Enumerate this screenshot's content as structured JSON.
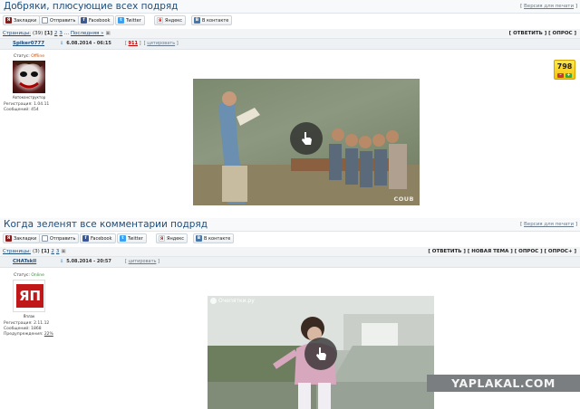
{
  "share": {
    "bookmarks": "Закладки",
    "send": "Отправить",
    "facebook": "Facebook",
    "twitter": "Twitter",
    "yandex": "Яндекс",
    "vk": "В контакте"
  },
  "topic1": {
    "title": "Добряки, плюсующие всех подряд",
    "print_link": "Версия для печати",
    "pages_label": "Страницы:",
    "pages_count": "(39)",
    "current_page": "[1]",
    "page2": "2",
    "page3": "3",
    "ellipsis": "...",
    "last": "Последняя »",
    "actions": "[ ОТВЕТИТЬ ] [ ОПРОС ]",
    "post": {
      "author": "Spiker0777",
      "date": "6.08.2014 - 06:15",
      "id": "911",
      "quote": "цитировать",
      "status_label": "Статус:",
      "status": "Offline",
      "rank": "Автоконструктор",
      "registered": "Регистрация: 1.04.11",
      "messages": "Сообщений: 454",
      "rating": "798",
      "minus": "–",
      "plus": "+"
    },
    "video_brand": "COUB"
  },
  "topic2": {
    "title": "Когда зеленят все комментарии подряд",
    "print_link": "Версия для печати",
    "pages_label": "Страницы:",
    "pages_count": "(3)",
    "current_page": "[1]",
    "page2": "2",
    "page3": "3",
    "actions": "[ ОТВЕТИТЬ ] [ НОВАЯ ТЕМА ] [ ОПРОС ] [ ОПРОС+ ]",
    "post": {
      "author": "CHATskll",
      "date": "5.08.2014 - 20:57",
      "quote": "цитировать",
      "status_label": "Статус:",
      "status": "Online",
      "avatar_text": "ЯП",
      "rank": "Яплак",
      "registered": "Регистрация: 2.11.12",
      "messages": "Сообщений: 1868",
      "warnings_label": "Предупреждения:",
      "warnings": "22%"
    },
    "video_channel": "Очепятки.ру"
  },
  "watermark": "YAPLAKAL.COM",
  "colors": {
    "title": "#1d4d7c",
    "offline": "#c84a00",
    "online": "#2f8d2f",
    "rating_bg": "#f4c20d",
    "post_id": "#c00000"
  }
}
